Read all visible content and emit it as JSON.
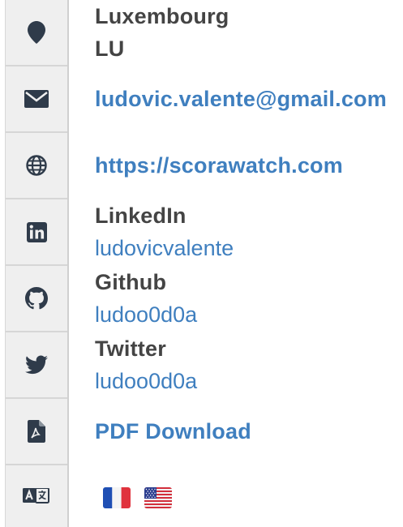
{
  "address": {
    "country": "Luxembourg",
    "code": "LU"
  },
  "email": "ludovic.valente@gmail.com",
  "website": "https://scorawatch.com",
  "social": [
    {
      "network": "LinkedIn",
      "handle": "ludovicvalente"
    },
    {
      "network": "Github",
      "handle": "ludoo0d0a"
    },
    {
      "network": "Twitter",
      "handle": "ludoo0d0a"
    }
  ],
  "pdf": {
    "label": "PDF Download"
  },
  "languages": [
    {
      "name": "French",
      "flag": "fr-flag"
    },
    {
      "name": "English (US)",
      "flag": "us-flag"
    }
  ],
  "icons": [
    "location-pin-icon",
    "envelope-icon",
    "globe-icon",
    "linkedin-icon",
    "github-icon",
    "twitter-icon",
    "pdf-file-icon",
    "translate-icon"
  ],
  "colors": {
    "link": "#3f7fbf",
    "heading": "#444444",
    "icon": "#2f3b4a",
    "sidebar": "#efefef"
  }
}
